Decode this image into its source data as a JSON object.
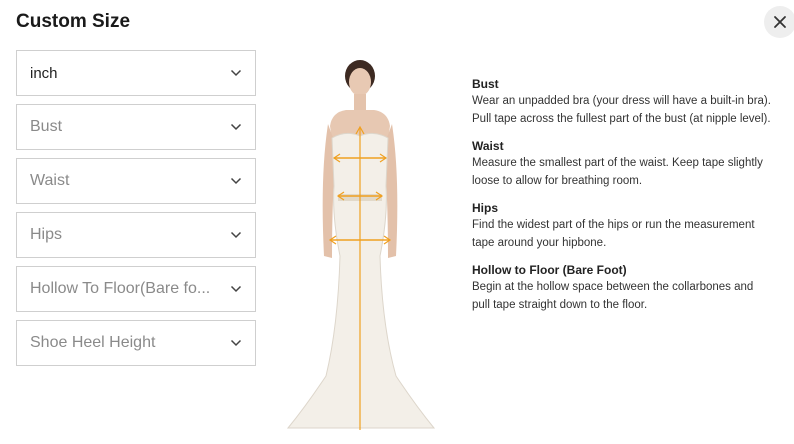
{
  "modal": {
    "title": "Custom Size"
  },
  "fields": [
    {
      "label": "inch",
      "filled": true
    },
    {
      "label": "Bust",
      "filled": false
    },
    {
      "label": "Waist",
      "filled": false
    },
    {
      "label": "Hips",
      "filled": false
    },
    {
      "label": "Hollow To Floor(Bare fo...",
      "filled": false
    },
    {
      "label": "Shoe Heel Height",
      "filled": false
    }
  ],
  "guide": [
    {
      "heading": "Bust",
      "text": "Wear an unpadded bra (your dress will have a built-in bra). Pull tape across the fullest part of the bust (at nipple level)."
    },
    {
      "heading": "Waist",
      "text": "Measure the smallest part of the waist. Keep tape slightly loose to allow for breathing room."
    },
    {
      "heading": "Hips",
      "text": "Find the widest part of the hips or run the measurement tape around your hipbone."
    },
    {
      "heading": "Hollow to Floor (Bare Foot)",
      "text": "Begin at the hollow space between the collarbones and pull tape straight down to the floor."
    }
  ],
  "colors": {
    "measure_lines": "#f0a020",
    "dress": "#f3efe8"
  }
}
